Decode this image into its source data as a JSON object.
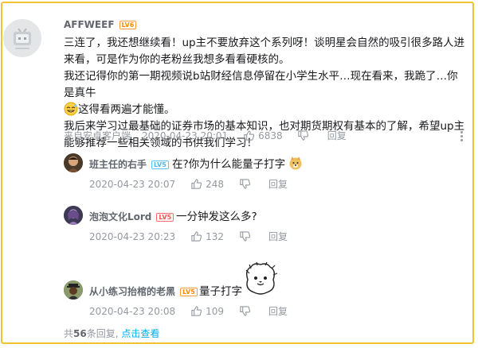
{
  "main_comment": {
    "username": "AFFWEEF",
    "level": "LV6",
    "lines": [
      "三连了，我还想继续看！up主不要放弃这个系列呀！谈明星会自然的吸引很多路人进来看，可是作为你的老粉丝我想多看看硬核的。",
      "我还记得你的第一期视频说b站财经信息停留在小学生水平…现在看来，我跪了…你是真牛",
      "这得看两遍才能懂。",
      "我后来学习过最基础的证券市场的基本知识，也对期货期权有基本的了解，希望up主能够推荐一些相关领域的书供我们学习！"
    ],
    "source": "来自安卓客户端",
    "time": "2020-04-23 20:01",
    "likes": "6838",
    "reply_label": "回复"
  },
  "replies": [
    {
      "username": "班主任的右手",
      "level": "LV5",
      "text": "在?你为什么能量子打字",
      "time": "2020-04-23 20:07",
      "likes": "248",
      "reply_label": "回复"
    },
    {
      "username": "泡泡文化Lord",
      "level": "LV5",
      "text": "一分钟发这么多?",
      "time": "2020-04-23 20:23",
      "likes": "132",
      "reply_label": "回复"
    },
    {
      "username": "从小练习抬棺的老黑",
      "level": "LV5",
      "text": "量子打字",
      "time": "2020-04-23 20:08",
      "likes": "109",
      "reply_label": "回复"
    }
  ],
  "footer": {
    "prefix": "共",
    "count": "56",
    "suffix": "条回复,",
    "link": "点击查看"
  },
  "colors": {
    "border": "#f2c230",
    "link": "#00aeec",
    "meta": "#9499a0"
  }
}
